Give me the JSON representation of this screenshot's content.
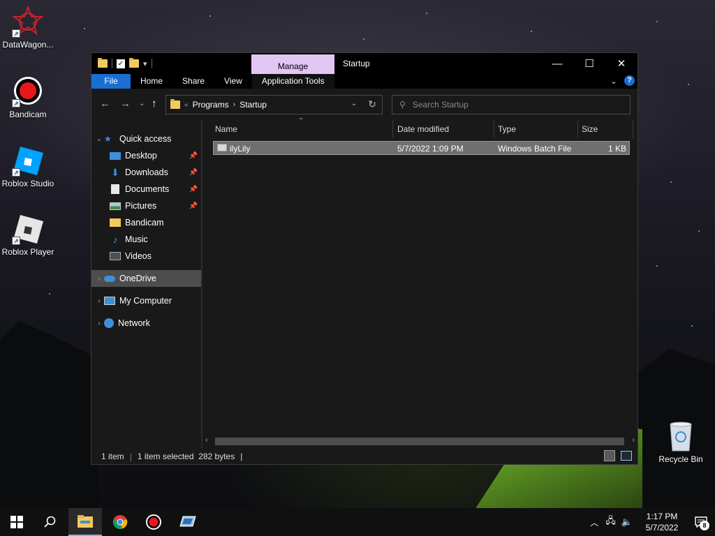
{
  "desktop": {
    "icons": [
      {
        "label": "DataWagon..."
      },
      {
        "label": "Bandicam"
      },
      {
        "label": "Roblox Studio"
      },
      {
        "label": "Roblox Player"
      },
      {
        "label": "Recycle Bin"
      }
    ]
  },
  "window": {
    "title": "Startup",
    "manage_tab": "Manage",
    "ribbon_tabs": [
      "File",
      "Home",
      "Share",
      "View",
      "Application Tools"
    ],
    "address": {
      "overflow": "«",
      "segments": [
        "Programs",
        "Startup"
      ]
    },
    "search": {
      "placeholder": "Search Startup"
    },
    "nav": {
      "quick_access": "Quick access",
      "items": [
        "Desktop",
        "Downloads",
        "Documents",
        "Pictures",
        "Bandicam",
        "Music",
        "Videos"
      ],
      "onedrive": "OneDrive",
      "my_computer": "My Computer",
      "network": "Network"
    },
    "columns": [
      "Name",
      "Date modified",
      "Type",
      "Size"
    ],
    "files": [
      {
        "name": "ilyLily",
        "date": "5/7/2022 1:09 PM",
        "type": "Windows Batch File",
        "size": "1 KB"
      }
    ],
    "status": {
      "count": "1 item",
      "selected": "1 item selected  282 bytes"
    }
  },
  "taskbar": {
    "time": "1:17 PM",
    "date": "5/7/2022",
    "notification_count": "8"
  },
  "colors": {
    "accent": "#1a6fd1",
    "manage_tab": "#e2c7f5",
    "selection": "#6f6f6f"
  }
}
